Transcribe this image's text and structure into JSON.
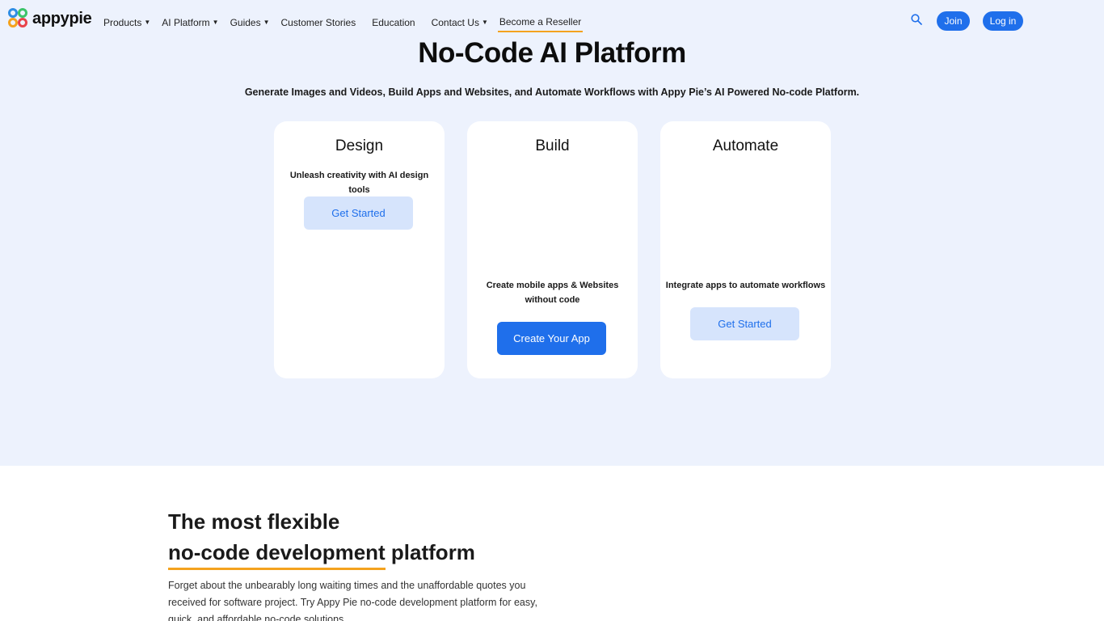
{
  "brand": {
    "name": "appypie"
  },
  "nav": {
    "items": [
      {
        "label": "Products",
        "dropdown": true
      },
      {
        "label": "AI Platform",
        "dropdown": true
      },
      {
        "label": "Guides",
        "dropdown": true
      },
      {
        "label": "Customer Stories",
        "dropdown": false
      },
      {
        "label": "Education",
        "dropdown": false
      },
      {
        "label": "Contact Us",
        "dropdown": true
      },
      {
        "label": "Become a Reseller",
        "dropdown": false,
        "active": true
      }
    ],
    "join_label": "Join",
    "login_label": "Log in"
  },
  "hero": {
    "title": "No-Code AI Platform",
    "subtitle": "Generate Images and Videos, Build Apps and Websites, and Automate Workflows with Appy Pie’s AI Powered No-code Platform."
  },
  "cards": [
    {
      "title": "Design",
      "description": "Unleash creativity with AI design tools",
      "button": "Get Started"
    },
    {
      "title": "Build",
      "description": "Create mobile apps & Websites without code",
      "button": "Create Your App"
    },
    {
      "title": "Automate",
      "description": "Integrate apps to automate workflows",
      "button": "Get Started"
    }
  ],
  "section2": {
    "title_line1": "The most flexible",
    "title_highlight": "no-code development",
    "title_rest": " platform",
    "body": "Forget about the unbearably long waiting times and the unaffordable quotes you received for software project. Try Appy Pie no-code development platform for easy, quick, and affordable no-code solutions."
  },
  "colors": {
    "accent": "#1f6feb",
    "underline": "#f4a21e",
    "hero_bg": "#edf2fd"
  },
  "icons": {
    "search": "search-icon",
    "caret": "chevron-down-icon"
  }
}
